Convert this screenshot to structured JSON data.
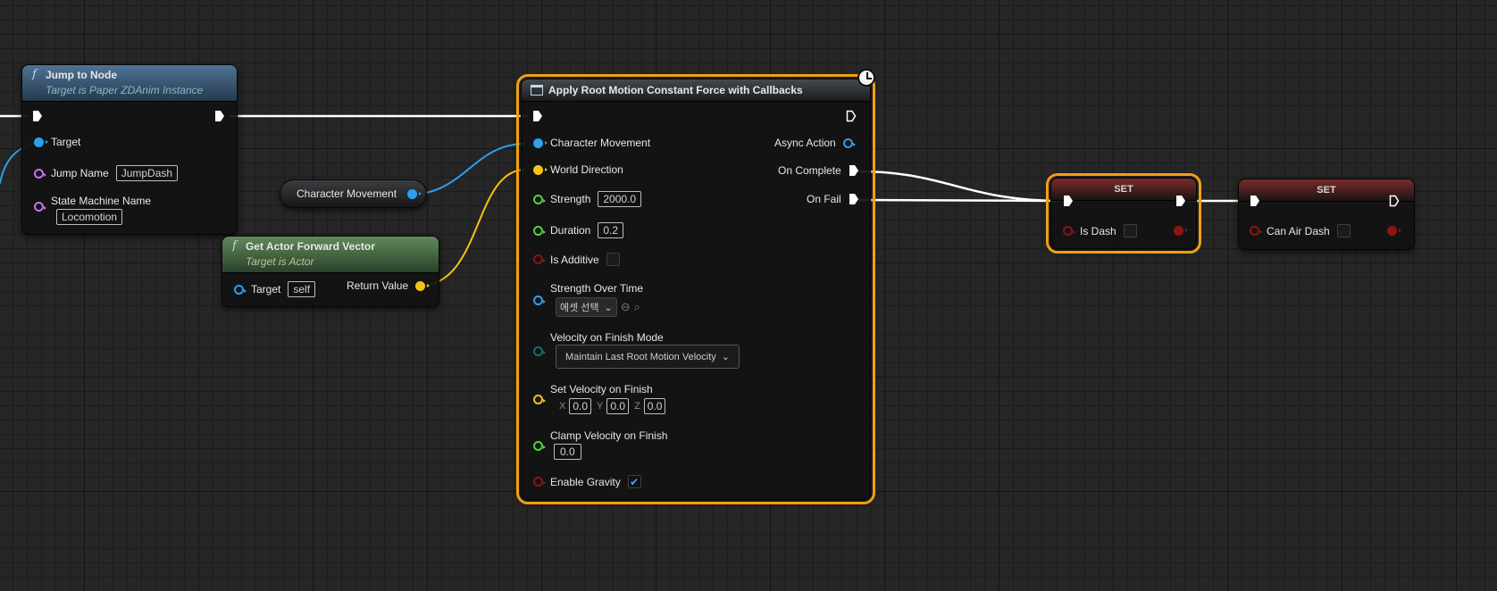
{
  "colors": {
    "exec": "#ffffff",
    "object_pin": "#2aa0ef",
    "vector_pin": "#f5c21a",
    "float_pin": "#4ad837",
    "bool_pin": "#8c1414",
    "name_pin": "#c472e8",
    "enum_pin": "#14706a",
    "selection": "#f0a012"
  },
  "jump_node": {
    "title": "Jump to Node",
    "subtitle": "Target is Paper ZDAnim Instance",
    "target_label": "Target",
    "jump_name_label": "Jump Name",
    "jump_name_value": "JumpDash",
    "state_machine_label": "State Machine Name",
    "state_machine_value": "Locomotion"
  },
  "char_move_var": {
    "label": "Character Movement"
  },
  "forward_node": {
    "title": "Get Actor Forward Vector",
    "subtitle": "Target is Actor",
    "target_label": "Target",
    "target_value": "self",
    "return_label": "Return Value"
  },
  "root_motion_node": {
    "title": "Apply Root Motion Constant Force with Callbacks",
    "inputs": {
      "character_movement": "Character Movement",
      "world_direction": "World Direction",
      "strength": "Strength",
      "strength_value": "2000.0",
      "duration": "Duration",
      "duration_value": "0.2",
      "is_additive": "Is Additive",
      "strength_over_time": "Strength Over Time",
      "asset_select": "에셋 선택",
      "velocity_finish_mode": "Velocity on Finish Mode",
      "velocity_finish_mode_value": "Maintain Last Root Motion Velocity",
      "set_velocity": "Set Velocity on Finish",
      "x_label": "X",
      "x_value": "0.0",
      "y_label": "Y",
      "y_value": "0.0",
      "z_label": "Z",
      "z_value": "0.0",
      "clamp_velocity": "Clamp Velocity on Finish",
      "clamp_value": "0.0",
      "enable_gravity": "Enable Gravity"
    },
    "outputs": {
      "async_action": "Async Action",
      "on_complete": "On Complete",
      "on_fail": "On Fail"
    },
    "enable_gravity_checked": true
  },
  "set_is_dash": {
    "title": "SET",
    "label": "Is Dash"
  },
  "set_can_air_dash": {
    "title": "SET",
    "label": "Can Air Dash"
  },
  "icons": [
    "function-icon",
    "clock-icon",
    "exec-pin-icon",
    "checkmark-icon",
    "chevron-down-icon",
    "browse-icon",
    "search-icon"
  ]
}
